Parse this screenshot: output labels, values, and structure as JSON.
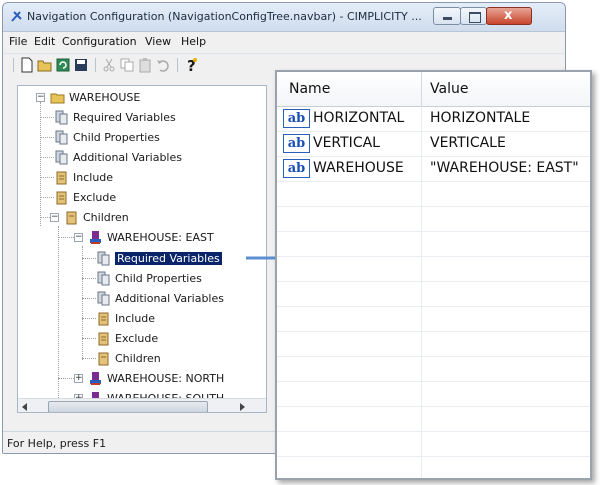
{
  "window": {
    "title": "Navigation Configuration (NavigationConfigTree.navbar) - CIMPLICITY ...",
    "close_glyph": "x"
  },
  "menubar": {
    "items": [
      "File",
      "Edit",
      "Configuration",
      "View",
      "Help"
    ]
  },
  "tree": {
    "root": "WAREHOUSE",
    "root_children": [
      "Required Variables",
      "Child Properties",
      "Additional Variables",
      "Include",
      "Exclude",
      "Children"
    ],
    "east": "WAREHOUSE: EAST",
    "east_children": [
      "Required Variables",
      "Child Properties",
      "Additional Variables",
      "Include",
      "Exclude",
      "Children"
    ],
    "north": "WAREHOUSE: NORTH",
    "south": "WAREHOUSE: SOUTH"
  },
  "status": {
    "text": "For Help, press F1"
  },
  "grid": {
    "name_header": "Name",
    "value_header": "Value",
    "icon_text": "ab",
    "rows": [
      {
        "name": "HORIZONTAL",
        "value": "HORIZONTALE"
      },
      {
        "name": "VERTICAL",
        "value": "VERTICALE"
      },
      {
        "name": "WAREHOUSE",
        "value": "\"WAREHOUSE: EAST\""
      }
    ]
  },
  "colors": {
    "accent": "#4a7fc9",
    "selection": "#0a246a",
    "folder": "#e8c35a"
  }
}
